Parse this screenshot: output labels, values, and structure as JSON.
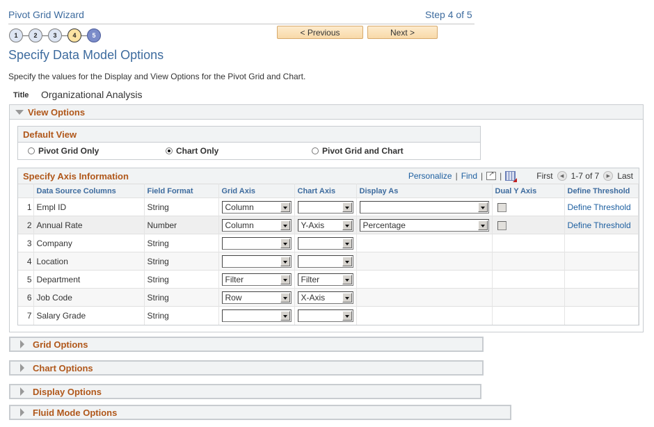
{
  "wizard": {
    "title": "Pivot Grid Wizard",
    "step_text": "Step 4 of 5",
    "steps": [
      "1",
      "2",
      "3",
      "4",
      "5"
    ],
    "current_step": 4,
    "prev_label": "< Previous",
    "next_label": "Next >"
  },
  "page": {
    "title": "Specify Data Model Options",
    "instructions": "Specify the values for the Display and View Options for the Pivot Grid and Chart.",
    "title_label": "Title",
    "title_value": "Organizational Analysis"
  },
  "view_options": {
    "label": "View Options",
    "default_view": {
      "label": "Default View",
      "options": [
        "Pivot Grid Only",
        "Chart Only",
        "Pivot Grid and Chart"
      ],
      "selected": "Chart Only"
    },
    "axis_grid": {
      "label": "Specify Axis Information",
      "personalize": "Personalize",
      "find": "Find",
      "first": "First",
      "range": "1-7 of 7",
      "last": "Last",
      "columns": [
        "Data Source Columns",
        "Field Format",
        "Grid Axis",
        "Chart Axis",
        "Display As",
        "Dual Y Axis",
        "Define Threshold"
      ],
      "rows": [
        {
          "num": "1",
          "column": "Empl ID",
          "format": "String",
          "grid_axis": "Column",
          "chart_axis": "",
          "display_as": "",
          "has_extra": true,
          "dual_y": false,
          "threshold": "Define Threshold"
        },
        {
          "num": "2",
          "column": "Annual Rate",
          "format": "Number",
          "grid_axis": "Column",
          "chart_axis": "Y-Axis",
          "display_as": "Percentage",
          "has_extra": true,
          "dual_y": false,
          "threshold": "Define Threshold"
        },
        {
          "num": "3",
          "column": "Company",
          "format": "String",
          "grid_axis": "",
          "chart_axis": "",
          "has_extra": false
        },
        {
          "num": "4",
          "column": "Location",
          "format": "String",
          "grid_axis": "",
          "chart_axis": "",
          "has_extra": false
        },
        {
          "num": "5",
          "column": "Department",
          "format": "String",
          "grid_axis": "Filter",
          "chart_axis": "Filter",
          "has_extra": false
        },
        {
          "num": "6",
          "column": "Job Code",
          "format": "String",
          "grid_axis": "Row",
          "chart_axis": "X-Axis",
          "has_extra": false
        },
        {
          "num": "7",
          "column": "Salary Grade",
          "format": "String",
          "grid_axis": "",
          "chart_axis": "",
          "has_extra": false
        }
      ]
    }
  },
  "collapsed_sections": [
    "Grid Options",
    "Chart Options",
    "Display Options",
    "Fluid Mode Options"
  ],
  "colors": {
    "link": "#1d5fa0",
    "heading": "#3d6b9e",
    "section_label": "#b0571a"
  }
}
